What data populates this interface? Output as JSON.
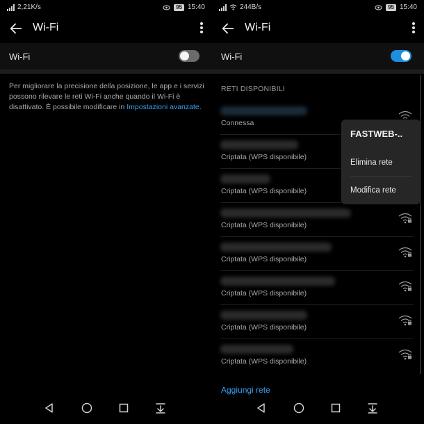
{
  "left": {
    "status": {
      "carrier": "4G",
      "speed": "2,21K/s",
      "battery": "95",
      "time": "15:40"
    },
    "appbar": {
      "title": "Wi-Fi"
    },
    "wifi_row": {
      "label": "Wi-Fi",
      "state": "off"
    },
    "info": {
      "text": "Per migliorare la precisione della posizione, le app e i servizi possono rilevare le reti Wi-Fi anche quando il Wi-Fi è disattivato. È possibile modificare in ",
      "link": "Impostazioni avanzate",
      "tail": "."
    }
  },
  "right": {
    "status": {
      "carrier": "4G",
      "speed": "244B/s",
      "battery": "95",
      "time": "15:40"
    },
    "appbar": {
      "title": "Wi-Fi"
    },
    "wifi_row": {
      "label": "Wi-Fi",
      "state": "on"
    },
    "section_header": "RETI DISPONIBILI",
    "networks": [
      {
        "status": "Connessa"
      },
      {
        "status": "Criptata (WPS disponibile)"
      },
      {
        "status": "Criptata (WPS disponibile)"
      },
      {
        "status": "Criptata (WPS disponibile)"
      },
      {
        "status": "Criptata (WPS disponibile)"
      },
      {
        "status": "Criptata (WPS disponibile)"
      },
      {
        "status": "Criptata (WPS disponibile)"
      },
      {
        "status": "Criptata (WPS disponibile)"
      }
    ],
    "add_network": "Aggiungi rete",
    "popup": {
      "title": "FASTWEB-..",
      "items": [
        "Elimina rete",
        "Modifica rete"
      ]
    }
  },
  "icons": {
    "back": "arrow-left-icon",
    "more": "more-vert-icon",
    "wifi": "wifi-icon",
    "wifi_locked": "wifi-lock-icon",
    "nav_back": "triangle-back-icon",
    "nav_home": "circle-home-icon",
    "nav_recents": "square-recents-icon",
    "nav_notifications": "pull-down-icon"
  },
  "colors": {
    "accent": "#1d8fe1",
    "link": "#3aa0ef",
    "background": "#000000"
  }
}
